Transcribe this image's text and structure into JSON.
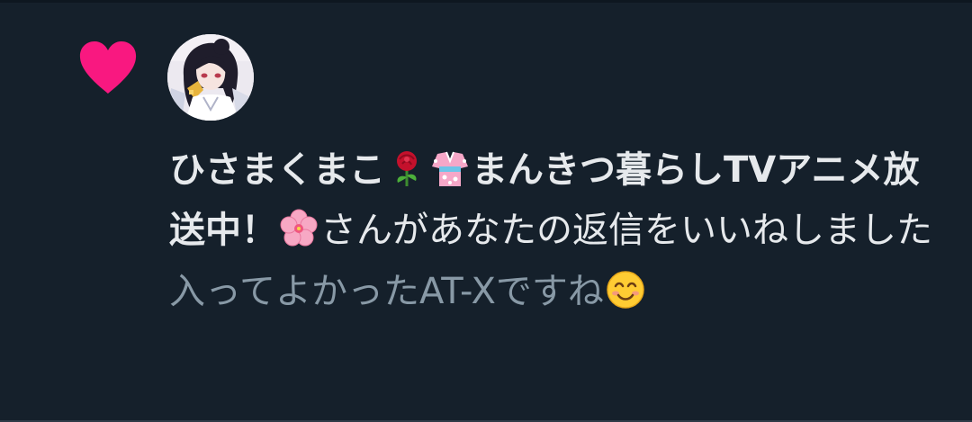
{
  "notification": {
    "type_icon": "heart-icon",
    "accent_color": "#f91880",
    "user": {
      "name_part1": "ひさまくまこ",
      "emoji_1": "rose-emoji",
      "emoji_2": "kimono-emoji",
      "name_part2": "まんきつ暮らしTVアニメ放送中！",
      "emoji_3": "cherry-blossom-emoji"
    },
    "action_text": "さんがあなたの返信をいいねしました",
    "reply": {
      "text": "入ってよかったAT-Xですね",
      "emoji": "smiling-face-emoji"
    }
  },
  "colors": {
    "background": "#15202b",
    "primary_text": "#e6e9ec",
    "secondary_text": "#8899a6"
  }
}
